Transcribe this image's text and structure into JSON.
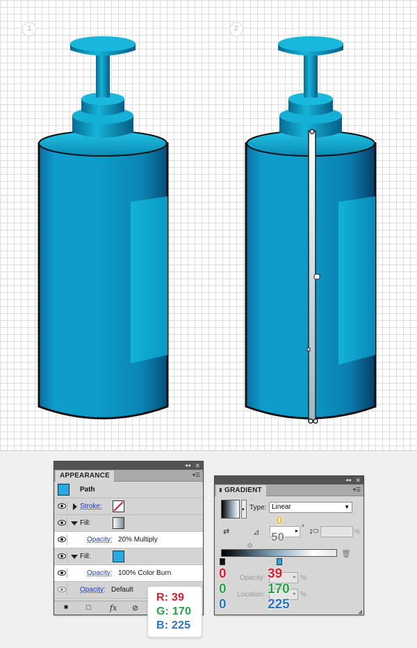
{
  "steps": [
    "1",
    "2"
  ],
  "appearance_panel": {
    "tab": "APPEARANCE",
    "header_icons": {
      "collapse": "◂◂",
      "close": "✕",
      "menu": "▾☰"
    },
    "object_label": "Path",
    "stroke_label": "Stroke:",
    "fill_label": "Fill:",
    "fill1_opacity_label": "Opacity:",
    "fill1_opacity_value": "20% Multiply",
    "fill2_opacity_label": "Opacity:",
    "fill2_opacity_value": "100% Color Burn",
    "opacity_label": "Opacity:",
    "opacity_value": "Default",
    "bottom_icons": [
      "new-art-icon",
      "clear-icon",
      "fx-icon",
      "delete-icon"
    ],
    "fx_label": "fx"
  },
  "gradient_panel": {
    "tab": "GRADIENT",
    "type_label": "Type:",
    "type_value": "Linear",
    "angle_value": "0",
    "degree_symbol": "°",
    "aspect_value": "50",
    "percent_symbol": "%",
    "opacity_label": "Opacity:",
    "location_label": "Location:",
    "stop1_rgb": [
      "0",
      "0",
      "0"
    ],
    "stop2_rgb": [
      "39",
      "170",
      "225"
    ]
  },
  "rgb_callout": {
    "r": "R: 39",
    "g": "G: 170",
    "b": "B: 225"
  },
  "colors": {
    "red": "#e01b2c",
    "green": "#23a346",
    "blue": "#2a72c2",
    "yellow": "#f0b52a",
    "swatch": "#27aae1",
    "bottle": "#0a92b8"
  }
}
